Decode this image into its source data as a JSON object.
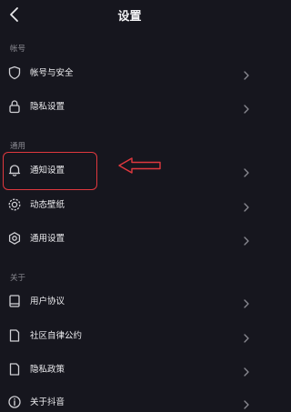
{
  "header": {
    "title": "设置"
  },
  "sections": [
    {
      "label": "帐号"
    },
    {
      "label": "通用"
    },
    {
      "label": "关于"
    }
  ],
  "rows": [
    {
      "label": "帐号与安全",
      "icon": "shield-icon"
    },
    {
      "label": "隐私设置",
      "icon": "lock-icon"
    },
    {
      "label": "通知设置",
      "icon": "bell-icon"
    },
    {
      "label": "动态壁纸",
      "icon": "wallpaper-icon"
    },
    {
      "label": "通用设置",
      "icon": "gear-icon"
    },
    {
      "label": "用户协议",
      "icon": "book-icon"
    },
    {
      "label": "社区自律公约",
      "icon": "document-icon"
    },
    {
      "label": "隐私政策",
      "icon": "document-icon"
    },
    {
      "label": "关于抖音",
      "icon": "info-icon"
    }
  ],
  "annotation": {
    "color": "#e0383e"
  }
}
